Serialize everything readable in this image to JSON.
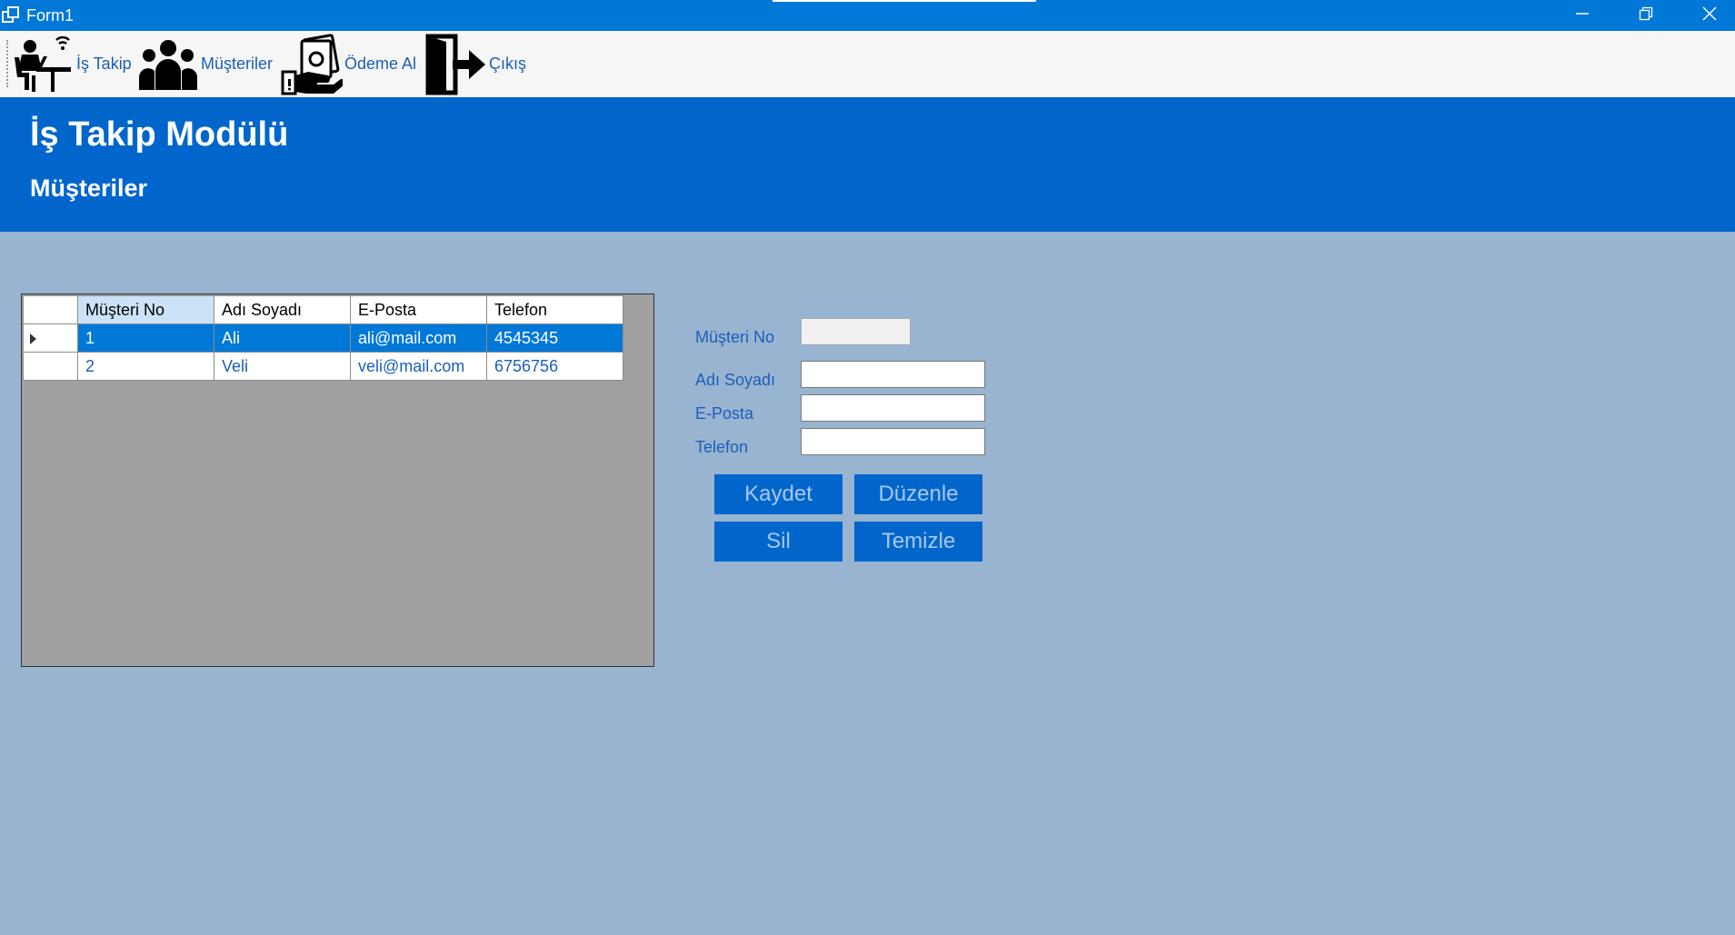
{
  "window": {
    "title": "Form1"
  },
  "toolbar": {
    "items": [
      {
        "label": "İş Takip",
        "icon": "worker-desk-icon"
      },
      {
        "label": "Müşteriler",
        "icon": "users-group-icon"
      },
      {
        "label": "Ödeme Al",
        "icon": "payment-cash-icon"
      },
      {
        "label": "Çıkış",
        "icon": "exit-door-icon"
      }
    ]
  },
  "header": {
    "title": "İş Takip Modülü",
    "subtitle": "Müşteriler"
  },
  "grid": {
    "columns": [
      "Müşteri No",
      "Adı Soyadı",
      "E-Posta",
      "Telefon"
    ],
    "rows": [
      {
        "no": "1",
        "name": "Ali",
        "email": "ali@mail.com",
        "phone": "4545345"
      },
      {
        "no": "2",
        "name": "Veli",
        "email": "veli@mail.com",
        "phone": "6756756"
      }
    ],
    "selected_row": 0
  },
  "form": {
    "labels": {
      "no": "Müşteri No",
      "name": "Adı Soyadı",
      "email": "E-Posta",
      "phone": "Telefon"
    },
    "values": {
      "no": "",
      "name": "",
      "email": "",
      "phone": ""
    },
    "buttons": {
      "save": "Kaydet",
      "edit": "Düzenle",
      "delete": "Sil",
      "clear": "Temizle"
    }
  },
  "colors": {
    "titlebar": "#0078d7",
    "header": "#0066cc",
    "background": "#99b4d1",
    "selection": "#0078d7",
    "label": "#1b5fb8"
  }
}
